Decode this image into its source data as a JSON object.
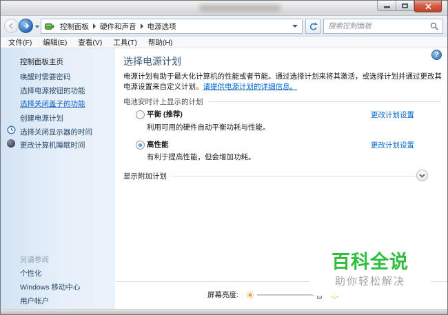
{
  "toolbar": {
    "breadcrumb": [
      "控制面板",
      "硬件和声音",
      "电源选项"
    ],
    "search_placeholder": "搜索控制面板"
  },
  "menubar": {
    "items": [
      "文件(F)",
      "编辑(E)",
      "查看(V)",
      "工具(T)",
      "帮助(H)"
    ]
  },
  "sidebar": {
    "home": "控制面板主页",
    "tasks": [
      "唤醒时需要密码",
      "选择电源按钮的功能",
      "选择关闭盖子的功能",
      "创建电源计划",
      "选择关闭显示器的时间",
      "更改计算机睡眠时间"
    ],
    "active_task": "选择关闭盖子的功能",
    "see_also_header": "另请参阅",
    "see_also_items": [
      "个性化",
      "Windows 移动中心",
      "用户帐户"
    ]
  },
  "main": {
    "title": "选择电源计划",
    "intro": "电源计划有助于最大化计算机的性能或者节能。通过选择计划来将其激活，或选择计划并通过更改其电源设置来自定义计划。",
    "intro_link": "请提供电源计划的详细信息。",
    "section_header": "电池安时计上显示的计划",
    "plans": [
      {
        "name": "平衡 (推荐)",
        "desc": "利用可用的硬件自动平衡功耗与性能。",
        "change_link": "更改计划设置",
        "selected": false
      },
      {
        "name": "高性能",
        "desc": "有利于提高性能，但会增加功耗。",
        "change_link": "更改计划设置",
        "selected": true
      }
    ],
    "show_additional": "显示附加计划",
    "help_glyph": "?"
  },
  "bottombar": {
    "brightness_label": "屏幕亮度:"
  },
  "watermark": {
    "title": "百科全说",
    "subtitle": "助你轻松解决"
  },
  "colors": {
    "link": "#0066cc",
    "heading": "#35597c",
    "active_task": "#0c63c5",
    "watermark_green": "#2fbe3c",
    "watermark_gray": "#a3a3a3"
  }
}
